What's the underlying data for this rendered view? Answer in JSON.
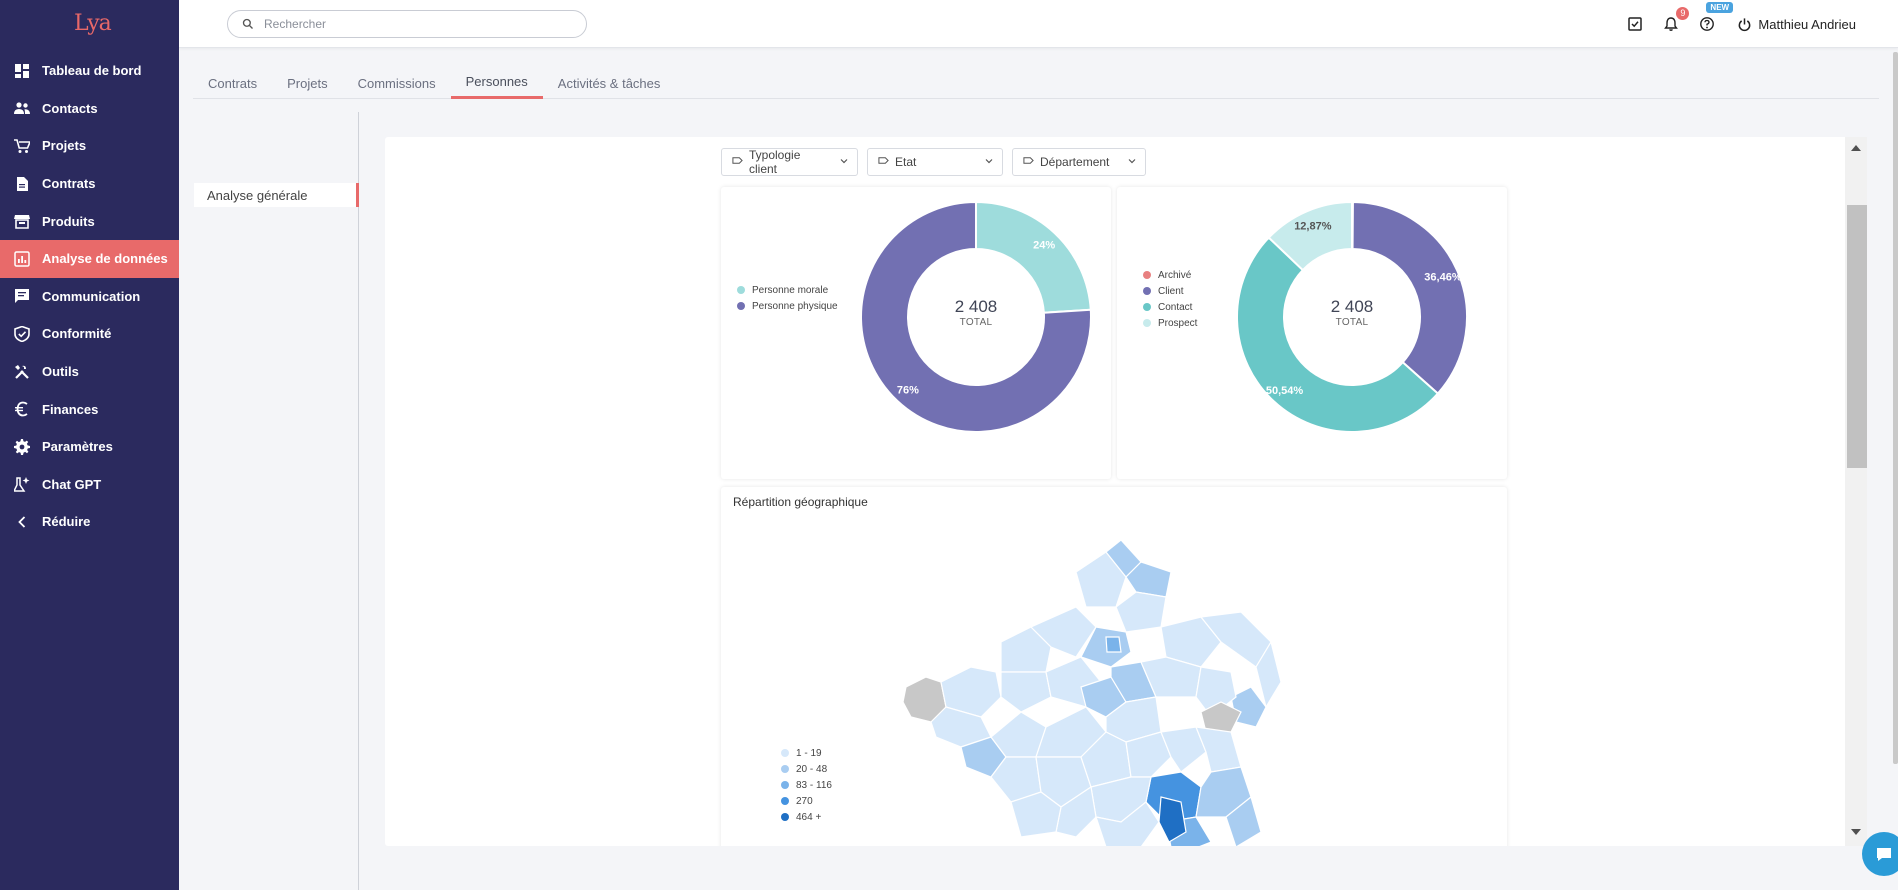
{
  "app": {
    "logo_text": "Lya",
    "brand_color": "#e86a6a",
    "sidebar_color": "#2b2a5e"
  },
  "sidebar": {
    "items": [
      {
        "label": "Tableau de bord",
        "icon": "dashboard-icon"
      },
      {
        "label": "Contacts",
        "icon": "people-icon"
      },
      {
        "label": "Projets",
        "icon": "cart-icon"
      },
      {
        "label": "Contrats",
        "icon": "document-icon"
      },
      {
        "label": "Produits",
        "icon": "store-icon"
      },
      {
        "label": "Analyse de données",
        "icon": "analytics-icon",
        "active": true
      },
      {
        "label": "Communication",
        "icon": "chat-icon"
      },
      {
        "label": "Conformité",
        "icon": "shield-icon"
      },
      {
        "label": "Outils",
        "icon": "tools-icon"
      },
      {
        "label": "Finances",
        "icon": "euro-icon"
      },
      {
        "label": "Paramètres",
        "icon": "gear-icon"
      },
      {
        "label": "Chat GPT",
        "icon": "ai-icon"
      },
      {
        "label": "Réduire",
        "icon": "chevron-left-icon"
      }
    ]
  },
  "topbar": {
    "search_placeholder": "Rechercher",
    "notifications_count": "9",
    "new_label": "NEW",
    "user_name": "Matthieu Andrieu"
  },
  "tabs": [
    {
      "label": "Contrats"
    },
    {
      "label": "Projets"
    },
    {
      "label": "Commissions"
    },
    {
      "label": "Personnes",
      "active": true
    },
    {
      "label": "Activités & tâches"
    }
  ],
  "subnav": {
    "active_label": "Analyse générale"
  },
  "filters": [
    {
      "label": "Typologie client"
    },
    {
      "label": "Etat"
    },
    {
      "label": "Département"
    }
  ],
  "chart_data": [
    {
      "type": "pie",
      "variant": "donut",
      "center_value": "2 408",
      "center_label": "TOTAL",
      "categories": [
        "Personne morale",
        "Personne physique"
      ],
      "values": [
        24,
        76
      ],
      "labels": [
        "24%",
        "76%"
      ],
      "colors": [
        "#9edcdc",
        "#7270b2"
      ],
      "legend_position": "left"
    },
    {
      "type": "pie",
      "variant": "donut",
      "center_value": "2 408",
      "center_label": "TOTAL",
      "categories": [
        "Archivé",
        "Client",
        "Contact",
        "Prospect"
      ],
      "values": [
        0.13,
        36.46,
        50.54,
        12.87
      ],
      "labels": [
        "",
        "36,46%",
        "50,54%",
        "12,87%"
      ],
      "colors": [
        "#e88080",
        "#7270b2",
        "#69c7c7",
        "#c7ebec"
      ],
      "legend_position": "left"
    }
  ],
  "map": {
    "title": "Répartition géographique",
    "legend": [
      {
        "label": "1 - 19",
        "color": "#d6e8fa"
      },
      {
        "label": "20 - 48",
        "color": "#a9cdf1"
      },
      {
        "label": "83 - 116",
        "color": "#7ab3ea"
      },
      {
        "label": "270",
        "color": "#4593e0"
      },
      {
        "label": "464 +",
        "color": "#1f6fc4"
      }
    ],
    "no_data_color": "#c8c8c8"
  }
}
